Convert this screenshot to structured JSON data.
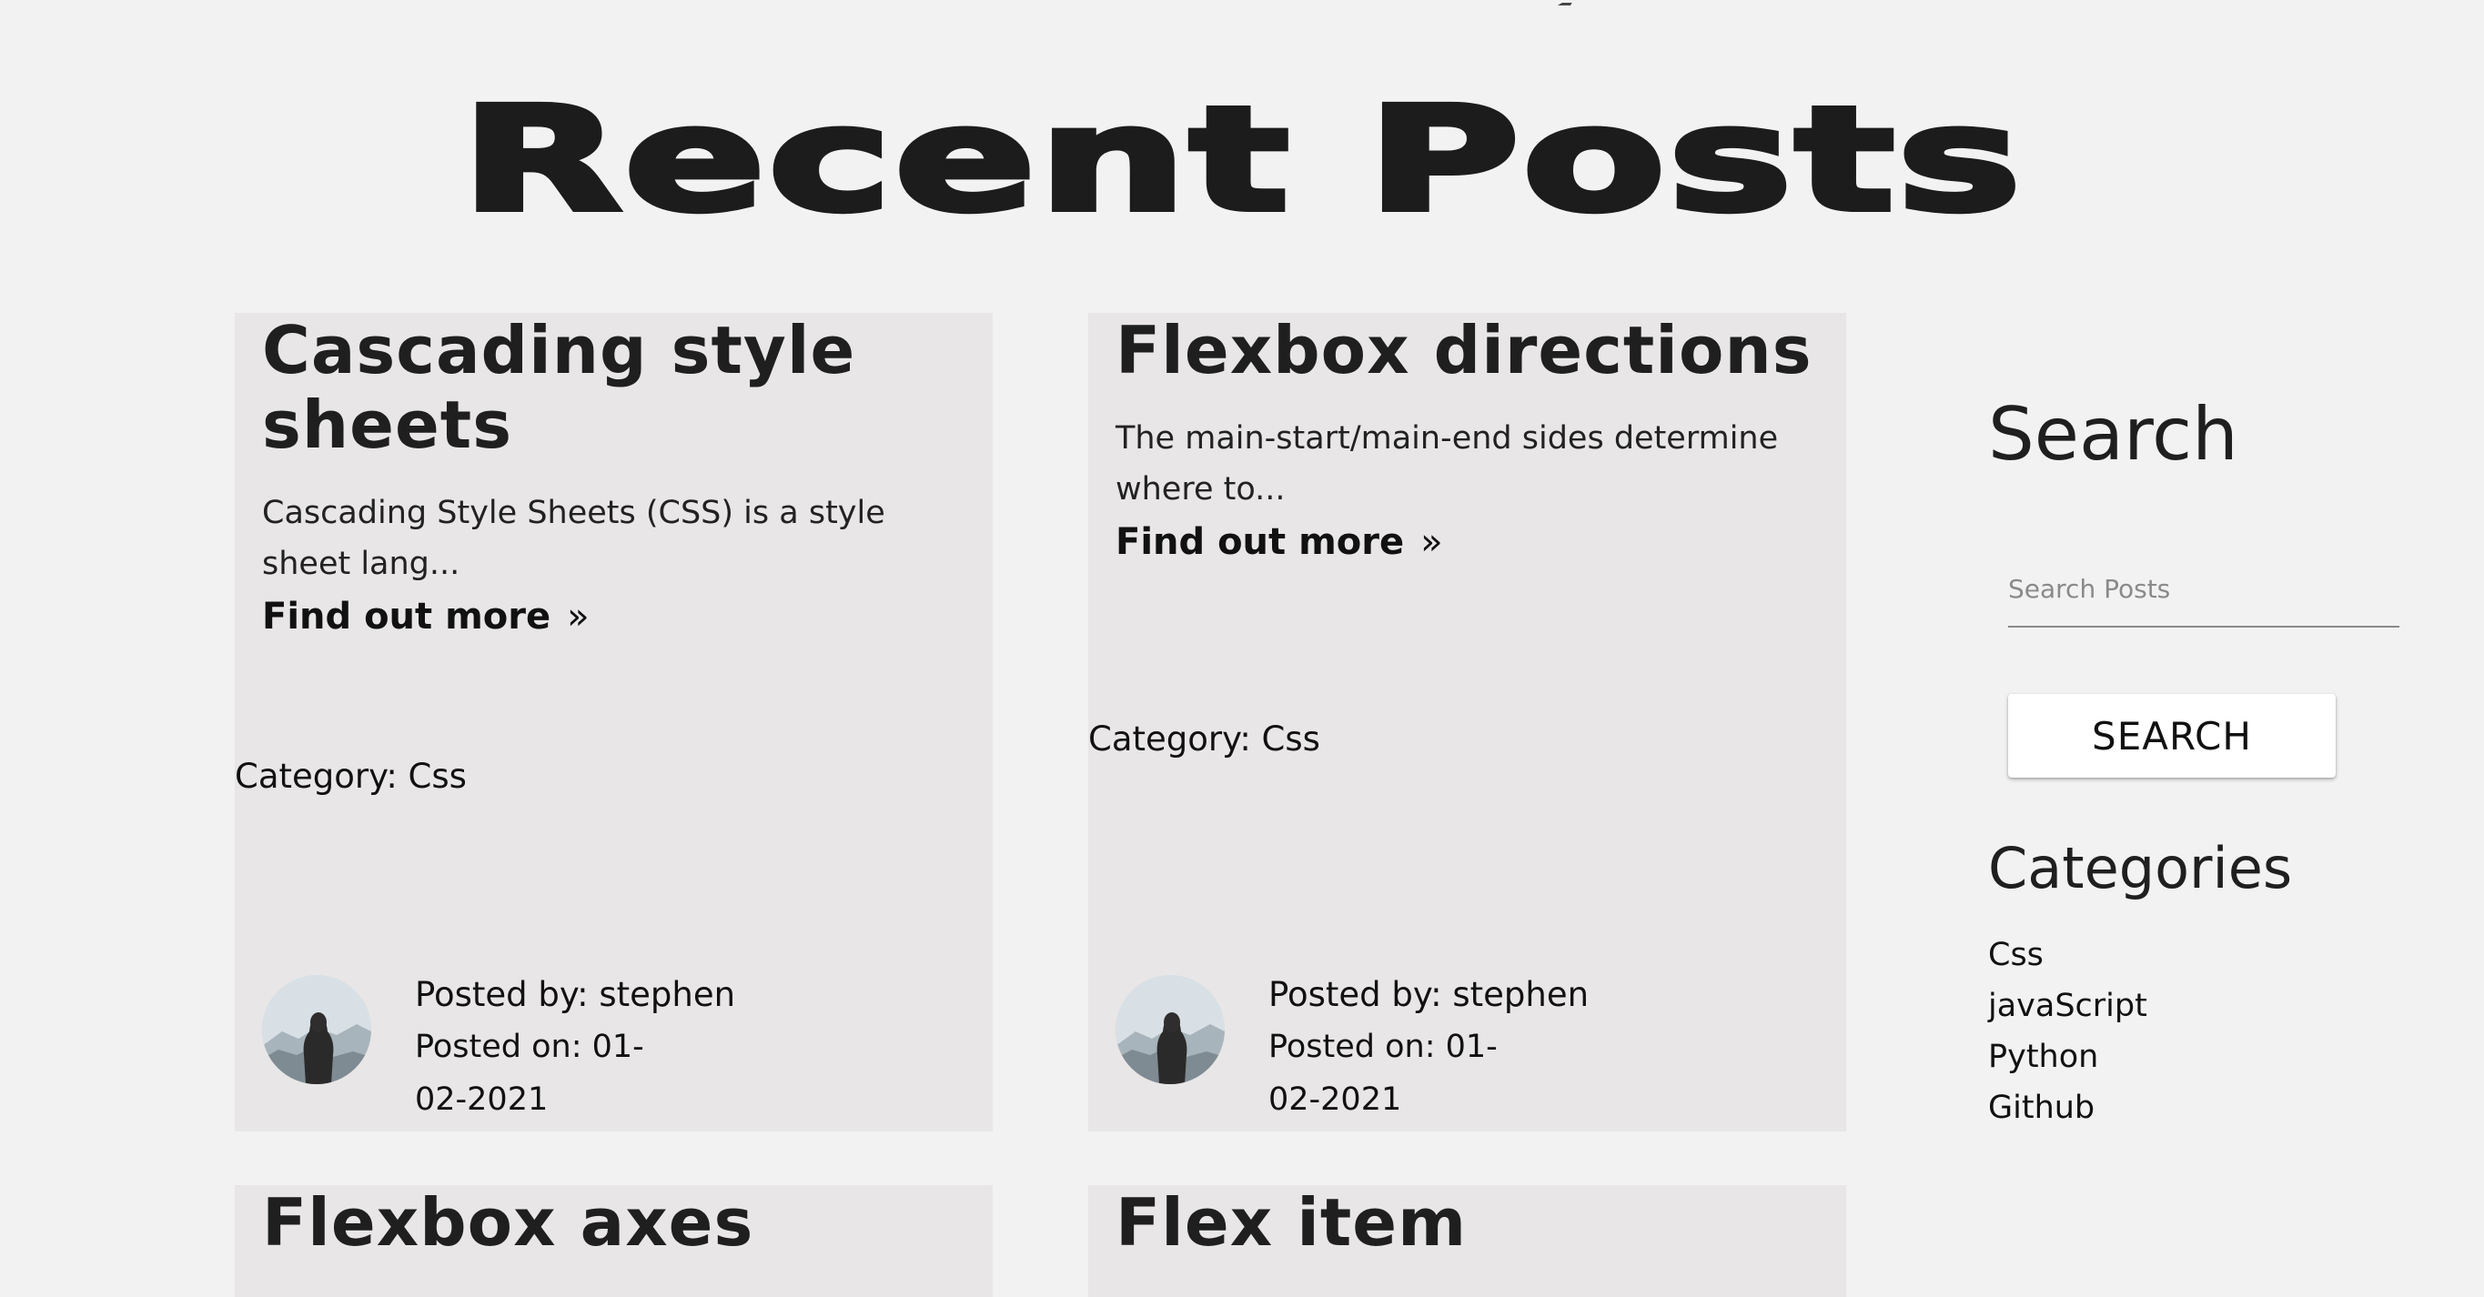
{
  "page": {
    "title": "Recent Posts"
  },
  "posts": [
    {
      "title": "Cascading style sheets",
      "excerpt": "Cascading Style Sheets (CSS) is a style sheet lang...",
      "find_more": "Find out more",
      "category": "Category: Css",
      "posted_by": "Posted by: stephen",
      "posted_on": "Posted on: 01-02-2021"
    },
    {
      "title": "Flexbox directions",
      "excerpt": "The main-start/main-end sides determine where to...",
      "find_more": "Find out more",
      "category": "Category: Css",
      "posted_by": "Posted by: stephen",
      "posted_on": "Posted on: 01-02-2021"
    },
    {
      "title": "Flexbox axes"
    },
    {
      "title": "Flex item"
    }
  ],
  "sidebar": {
    "search_heading": "Search",
    "search_placeholder": "Search Posts",
    "search_button": "SEARCH",
    "categories_heading": "Categories",
    "categories": [
      "Css",
      "javaScript",
      "Python",
      "Github"
    ]
  },
  "icons": {
    "find_more": "double-chevron-right-icon",
    "avatar": "hooded-figure-mountains-avatar"
  },
  "colors": {
    "background": "#f2f2f2",
    "card": "#e8e6e6",
    "text": "#1f1f1f",
    "button": "#ffffff"
  }
}
